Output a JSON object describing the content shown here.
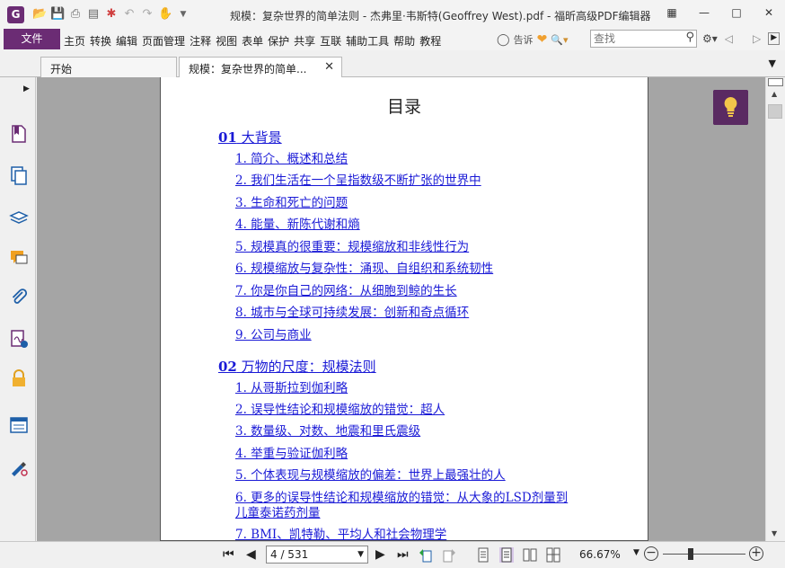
{
  "window": {
    "title": "规模：复杂世界的简单法则 - 杰弗里·韦斯特(Geoffrey West).pdf - 福昕高级PDF编辑器",
    "app_logo": "G"
  },
  "menu": {
    "file": "文件",
    "items": [
      "主页",
      "转换",
      "编辑",
      "页面管理",
      "注释",
      "视图",
      "表单",
      "保护",
      "共享",
      "互联",
      "辅助工具",
      "帮助",
      "教程"
    ],
    "tell_me": "告诉",
    "search_placeholder": "查找",
    "search_value": ""
  },
  "tabs": [
    {
      "label": "开始",
      "active": false
    },
    {
      "label": "规模：复杂世界的简单...",
      "active": true
    }
  ],
  "document": {
    "toc_title": "目录",
    "sections": [
      {
        "num": "01",
        "title": " 大背景",
        "entries": [
          "1. 简介、概述和总结",
          "2. 我们生活在一个呈指数级不断扩张的世界中",
          "3. 生命和死亡的问题",
          "4. 能量、新陈代谢和熵",
          "5. 规模真的很重要：规模缩放和非线性行为",
          "6. 规模缩放与复杂性：涌现、自组织和系统韧性",
          "7. 你是你自己的网络：从细胞到鲸的生长",
          "8. 城市与全球可持续发展：创新和奇点循环",
          "9. 公司与商业"
        ]
      },
      {
        "num": "02",
        "title": " 万物的尺度：规模法则",
        "entries": [
          "1. 从哥斯拉到伽利略",
          "2. 误导性结论和规模缩放的错觉：超人",
          "3. 数量级、对数、地震和里氏震级",
          "4. 举重与验证伽利略",
          "5. 个体表现与规模缩放的偏差：世界上最强壮的人",
          "6. 更多的误导性结论和规模缩放的错觉：从大象的LSD剂量到",
          "儿童泰诺药剂量",
          "7. BMI、凯特勒、平均人和社会物理学"
        ]
      }
    ]
  },
  "status": {
    "page": "4 / 531",
    "zoom": "66.67%"
  },
  "colors": {
    "brand": "#6b2c74",
    "link": "#1a1ad6",
    "canvas": "#a5a5a5"
  }
}
